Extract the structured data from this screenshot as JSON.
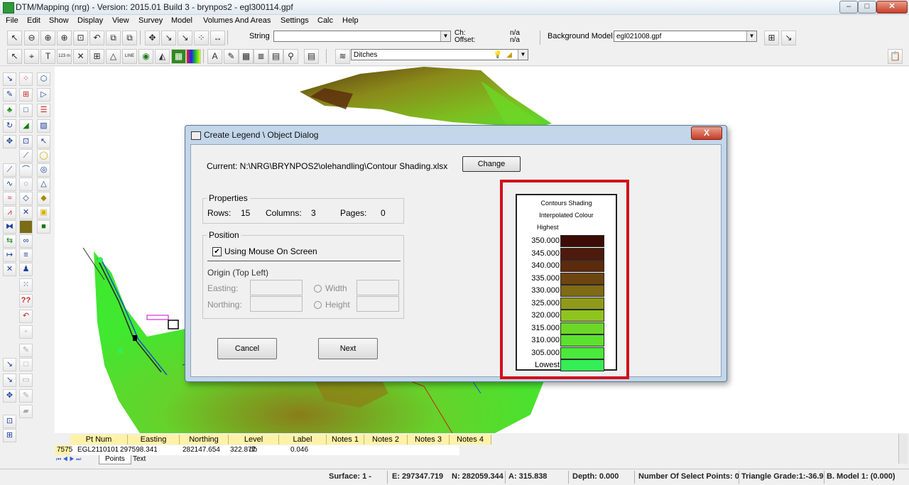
{
  "window": {
    "title": "DTM/Mapping (nrg) - Version: 2015.01 Build 3 - brynpos2 - egl300114.gpf"
  },
  "menu": [
    "File",
    "Edit",
    "Show",
    "Display",
    "View",
    "Survey",
    "Model",
    "Volumes And Areas",
    "Settings",
    "Calc",
    "Help"
  ],
  "toolbar1": {
    "string_label": "String",
    "string_value": "",
    "ch_label": "Ch:",
    "offset_label": "Offset:",
    "ch_value": "n/a",
    "offset_value": "n/a",
    "background_model_label": "Background Model:",
    "background_model_value": "egl021008.gpf"
  },
  "toolbar2": {
    "layer_value": "Ditches",
    "small_icon_text_1": "T",
    "small_icon_text_2": "123 m",
    "small_icon_text_3": "LINE"
  },
  "dialog": {
    "title": "Create Legend \\ Object Dialog",
    "close_label": "X",
    "current_label": "Current: N:\\NRG\\BRYNPOS2\\olehandling\\Contour Shading.xlsx",
    "change_label": "Change",
    "properties": {
      "title": "Properties",
      "rows_label": "Rows:",
      "rows_value": "15",
      "columns_label": "Columns:",
      "columns_value": "3",
      "pages_label": "Pages:",
      "pages_value": "0"
    },
    "position": {
      "title": "Position",
      "mouse_checkbox_label": "Using Mouse On Screen",
      "mouse_checked": true,
      "origin_label": "Origin (Top Left)",
      "easting_label": "Easting:",
      "northing_label": "Northing:",
      "width_label": "Width",
      "height_label": "Height"
    },
    "cancel_label": "Cancel",
    "next_label": "Next"
  },
  "legend": {
    "title": "Contours Shading",
    "subtitle": "Interpolated Colour",
    "highest_label": "Highest",
    "rows": [
      {
        "label": "350.000",
        "color": "#3b0d06"
      },
      {
        "label": "345.000",
        "color": "#4e1a0b"
      },
      {
        "label": "340.000",
        "color": "#5c2a0c"
      },
      {
        "label": "335.000",
        "color": "#6c4510"
      },
      {
        "label": "330.000",
        "color": "#7f6a16"
      },
      {
        "label": "325.000",
        "color": "#8f9a1a"
      },
      {
        "label": "320.000",
        "color": "#8fc41f"
      },
      {
        "label": "315.000",
        "color": "#6cd726"
      },
      {
        "label": "310.000",
        "color": "#5be12e"
      },
      {
        "label": "305.000",
        "color": "#4aea3b"
      },
      {
        "label": "Lowest",
        "color": "#33ee55"
      }
    ]
  },
  "grid": {
    "headers": [
      "Pt Num",
      "Easting",
      "Northing",
      "Level",
      "Label",
      "Notes 1",
      "Notes 2",
      "Notes 3",
      "Notes 4"
    ],
    "row": {
      "id": "7575",
      "pt_num": "EGL2110101",
      "easting": "297598.341",
      "northing": "282147.654",
      "level": "322.877",
      "label": "db",
      "notes1": "0.046"
    },
    "tabs": [
      "Points",
      "Text"
    ]
  },
  "status": {
    "surface": "Surface: 1 -",
    "e": "E: 297347.719",
    "n": "N: 282059.344",
    "a": "A: 315.838",
    "depth": "Depth: 0.000",
    "select_points": "Number Of Select Points: 0",
    "triangle_grade": "Triangle Grade:1:-36.9",
    "b_model": "B. Model 1: (0.000)"
  },
  "colors": {
    "legend_highlight": "#d0111c",
    "grid_header": "#fff2a8",
    "terrain_green": "#44e030",
    "terrain_brown": "#6d4c14"
  }
}
